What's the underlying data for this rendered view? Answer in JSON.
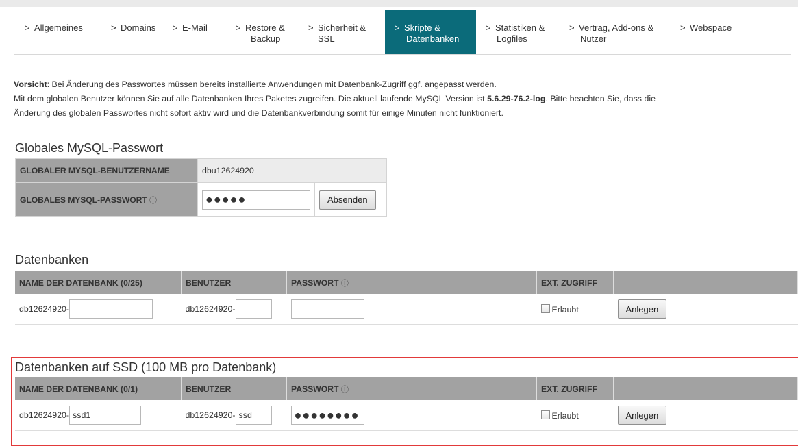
{
  "nav": {
    "tabs": [
      {
        "l1": "Allgemeines",
        "l2": ""
      },
      {
        "l1": "Domains",
        "l2": ""
      },
      {
        "l1": "E-Mail",
        "l2": ""
      },
      {
        "l1": "Restore &",
        "l2": "Backup"
      },
      {
        "l1": "Sicherheit &",
        "l2": "SSL"
      },
      {
        "l1": "Skripte &",
        "l2": "Datenbanken"
      },
      {
        "l1": "Statistiken &",
        "l2": "Logfiles"
      },
      {
        "l1": "Vertrag, Add-ons &",
        "l2": "Nutzer"
      },
      {
        "l1": "Webspace",
        "l2": ""
      }
    ],
    "active_index": 5,
    "chevron": ">"
  },
  "intro": {
    "warn_label": "Vorsicht",
    "warn_text": ": Bei Änderung des Passwortes müssen bereits installierte Anwendungen mit Datenbank-Zugriff ggf. angepasst werden.",
    "line2_a": "Mit dem globalen Benutzer können Sie auf alle Datenbanken Ihres Paketes zugreifen. Die aktuell laufende MySQL Version ist ",
    "version": "5.6.29-76.2-log",
    "line2_b": ". Bitte beachten Sie, dass die",
    "line3": "Änderung des globalen Passwortes nicht sofort aktiv wird und die Datenbankverbindung somit für einige Minuten nicht funktioniert."
  },
  "global": {
    "heading": "Globales MySQL-Passwort",
    "user_label": "GLOBALER MYSQL-BENUTZERNAME",
    "user_value": "dbu12624920",
    "pw_label": "GLOBALES MYSQL-PASSWORT",
    "info_icon": "ⓘ",
    "pw_value": "●●●●●",
    "submit": "Absenden"
  },
  "databases": {
    "heading": "Datenbanken",
    "col_name": "NAME DER DATENBANK (0/25)",
    "col_user": "BENUTZER",
    "col_pw": "PASSWORT",
    "col_ext": "EXT. ZUGRIFF",
    "name_prefix": "db12624920-",
    "name_value": "",
    "user_prefix": "db12624920-",
    "user_value": "",
    "pw_value": "",
    "ext_label": "Erlaubt",
    "create": "Anlegen"
  },
  "ssd": {
    "heading": "Datenbanken auf SSD (100 MB pro Datenbank)",
    "col_name": "NAME DER DATENBANK (0/1)",
    "col_user": "BENUTZER",
    "col_pw": "PASSWORT",
    "col_ext": "EXT. ZUGRIFF",
    "name_prefix": "db12624920-",
    "name_value": "ssd1",
    "user_prefix": "db12624920-",
    "user_value": "ssd",
    "pw_value": "●●●●●●●●",
    "ext_label": "Erlaubt",
    "create": "Anlegen"
  },
  "colors": {
    "active_tab": "#0b6b7a",
    "label_bg": "#a2a2a2",
    "highlight_border": "#e23a3a"
  }
}
